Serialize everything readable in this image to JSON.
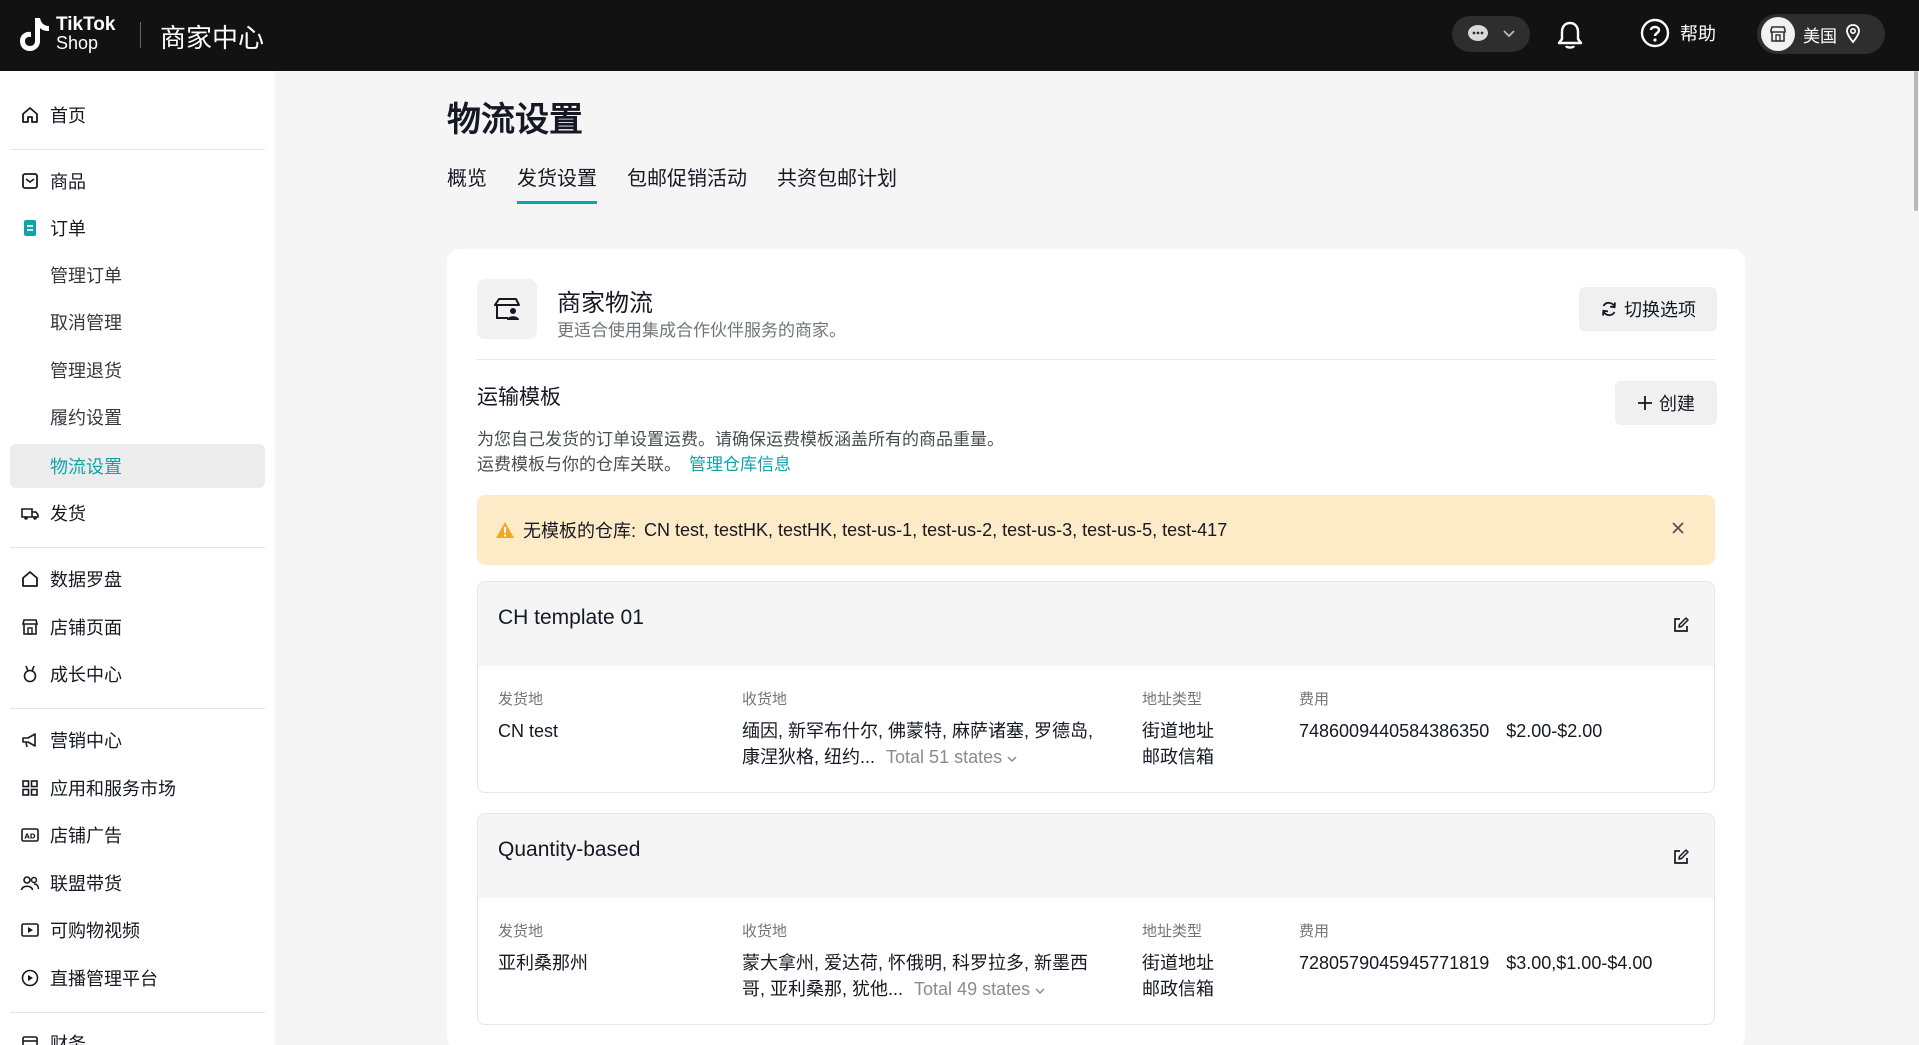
{
  "topbar": {
    "logo_line1": "TikTok",
    "logo_line2": "Shop",
    "app_title": "商家中心",
    "help_label": "帮助",
    "region_label": "美国"
  },
  "sidebar": {
    "items": [
      {
        "label": "首页",
        "icon": "home-icon"
      },
      {
        "label": "商品",
        "icon": "product-icon"
      },
      {
        "label": "订单",
        "icon": "order-icon"
      },
      {
        "label": "管理订单"
      },
      {
        "label": "取消管理"
      },
      {
        "label": "管理退货"
      },
      {
        "label": "履约设置"
      },
      {
        "label": "物流设置"
      },
      {
        "label": "发货",
        "icon": "shipping-icon"
      },
      {
        "label": "数据罗盘",
        "icon": "compass-icon"
      },
      {
        "label": "店铺页面",
        "icon": "store-icon"
      },
      {
        "label": "成长中心",
        "icon": "medal-icon"
      },
      {
        "label": "营销中心",
        "icon": "megaphone-icon"
      },
      {
        "label": "应用和服务市场",
        "icon": "apps-icon"
      },
      {
        "label": "店铺广告",
        "icon": "ad-icon"
      },
      {
        "label": "联盟带货",
        "icon": "affiliate-icon"
      },
      {
        "label": "可购物视频",
        "icon": "video-icon"
      },
      {
        "label": "直播管理平台",
        "icon": "live-icon"
      },
      {
        "label": "财务",
        "icon": "finance-icon"
      }
    ]
  },
  "main": {
    "page_title": "物流设置",
    "tabs": [
      {
        "label": "概览"
      },
      {
        "label": "发货设置"
      },
      {
        "label": "包邮促销活动"
      },
      {
        "label": "共资包邮计划"
      }
    ],
    "section": {
      "title": "商家物流",
      "subtitle": "更适合使用集成合作伙伴服务的商家。",
      "switch_label": "切换选项"
    },
    "templates_section": {
      "title": "运输模板",
      "create_label": "创建",
      "desc1": "为您自己发货的订单设置运费。请确保运费模板涵盖所有的商品重量。",
      "desc2": "运费模板与你的仓库关联。",
      "link_label": "管理仓库信息"
    },
    "warning": {
      "label": "无模板的仓库:",
      "warehouses": "CN test, testHK, testHK, test-us-1, test-us-2, test-us-3, test-us-5, test-417"
    },
    "column_labels": {
      "origin": "发货地",
      "destination": "收货地",
      "address_type": "地址类型",
      "fee": "费用"
    },
    "templates": [
      {
        "name": "CH template 01",
        "origin": "CN test",
        "dest_line1": "缅因, 新罕布什尔, 佛蒙特, 麻萨诸塞, 罗德岛,",
        "dest_line2": "康涅狄格, 纽约...",
        "dest_total": "Total 51 states",
        "addr1": "街道地址",
        "addr2": "邮政信箱",
        "fee_id": "7486009440584386350",
        "fee_range": "$2.00-$2.00"
      },
      {
        "name": "Quantity-based",
        "origin": "亚利桑那州",
        "dest_line1": "蒙大拿州, 爱达荷, 怀俄明, 科罗拉多, 新墨西",
        "dest_line2": "哥, 亚利桑那, 犹他...",
        "dest_total": "Total 49 states",
        "addr1": "街道地址",
        "addr2": "邮政信箱",
        "fee_id": "7280579045945771819",
        "fee_range": "$3.00,$1.00-$4.00"
      }
    ]
  },
  "colors": {
    "accent": "#10a3a8",
    "topbar_bg": "#121212",
    "warning_bg": "#fdebc8",
    "warning_icon": "#f5a623"
  }
}
